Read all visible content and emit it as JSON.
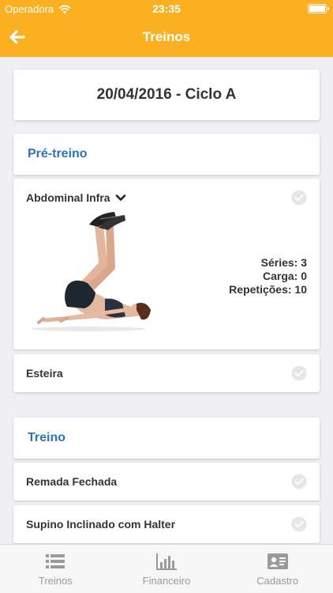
{
  "status_bar": {
    "carrier": "Operadora",
    "time": "23:35"
  },
  "nav": {
    "title": "Treinos"
  },
  "workout": {
    "date_title": "20/04/2016 - Ciclo A"
  },
  "sections": [
    {
      "title": "Pré-treino",
      "exercises": [
        {
          "name": "Abdominal Infra",
          "expanded": true,
          "stats": {
            "series": "Séries: 3",
            "carga": "Carga: 0",
            "repeticoes": "Repetições: 10"
          }
        },
        {
          "name": "Esteira"
        }
      ]
    },
    {
      "title": "Treino",
      "exercises": [
        {
          "name": "Remada Fechada"
        },
        {
          "name": "Supino Inclinado com Halter"
        }
      ]
    }
  ],
  "tabs": [
    {
      "label": "Treinos",
      "icon": "list-icon"
    },
    {
      "label": "Financeiro",
      "icon": "bar-chart-icon"
    },
    {
      "label": "Cadastro",
      "icon": "id-card-icon"
    }
  ],
  "colors": {
    "header": "#fbb022",
    "section_title": "#2b74b9",
    "tab_inactive": "#999999"
  }
}
